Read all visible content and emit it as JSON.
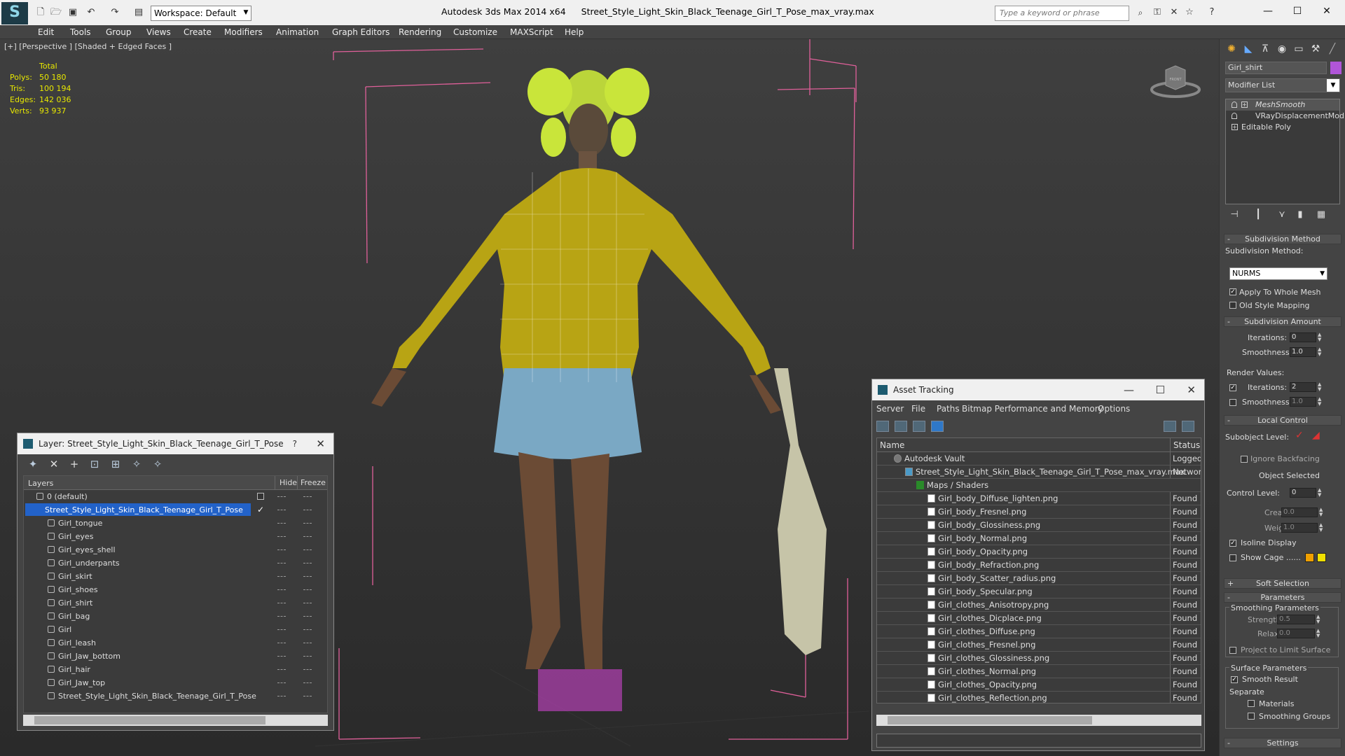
{
  "titlebar": {
    "workspace": "Workspace: Default",
    "app": "Autodesk 3ds Max  2014 x64",
    "file": "Street_Style_Light_Skin_Black_Teenage_Girl_T_Pose_max_vray.max",
    "search_placeholder": "Type a keyword or phrase",
    "controls": {
      "minimize": "—",
      "maximize": "☐",
      "close": "✕"
    }
  },
  "menu": [
    "Edit",
    "Tools",
    "Group",
    "Views",
    "Create",
    "Modifiers",
    "Animation",
    "Graph Editors",
    "Rendering",
    "Customize",
    "MAXScript",
    "Help"
  ],
  "viewport": {
    "label": "[+] [Perspective ] [Shaded + Edged Faces ]",
    "stats": {
      "header": "Total",
      "rows": [
        {
          "k": "Polys:",
          "v": "50 180"
        },
        {
          "k": "Tris:",
          "v": "100 194"
        },
        {
          "k": "Edges:",
          "v": "142 036"
        },
        {
          "k": "Verts:",
          "v": "93 937"
        }
      ]
    },
    "viewcube": "FRONT"
  },
  "layer_window": {
    "title": "Layer: Street_Style_Light_Skin_Black_Teenage_Girl_T_Pose",
    "help": "?",
    "close": "✕",
    "columns": {
      "layers": "Layers",
      "hide": "Hide",
      "freeze": "Freeze"
    },
    "rows": [
      {
        "name": "0 (default)",
        "indent": 1,
        "selected": false
      },
      {
        "name": "Street_Style_Light_Skin_Black_Teenage_Girl_T_Pose",
        "indent": 1,
        "selected": true
      },
      {
        "name": "Girl_tongue",
        "indent": 2
      },
      {
        "name": "Girl_eyes",
        "indent": 2
      },
      {
        "name": "Girl_eyes_shell",
        "indent": 2
      },
      {
        "name": "Girl_underpants",
        "indent": 2
      },
      {
        "name": "Girl_skirt",
        "indent": 2
      },
      {
        "name": "Girl_shoes",
        "indent": 2
      },
      {
        "name": "Girl_shirt",
        "indent": 2
      },
      {
        "name": "Girl_bag",
        "indent": 2
      },
      {
        "name": "Girl",
        "indent": 2
      },
      {
        "name": "Girl_leash",
        "indent": 2
      },
      {
        "name": "Girl_Jaw_bottom",
        "indent": 2
      },
      {
        "name": "Girl_hair",
        "indent": 2
      },
      {
        "name": "Girl_Jaw_top",
        "indent": 2
      },
      {
        "name": "Street_Style_Light_Skin_Black_Teenage_Girl_T_Pose",
        "indent": 2
      }
    ]
  },
  "asset_window": {
    "title": "Asset Tracking",
    "controls": {
      "minimize": "—",
      "maximize": "☐",
      "close": "✕"
    },
    "menu": [
      "Server",
      "File",
      "Paths",
      "Bitmap Performance and Memory",
      "Options"
    ],
    "columns": {
      "name": "Name",
      "status": "Status"
    },
    "rows": [
      {
        "name": "Autodesk Vault",
        "status": "Logged O",
        "indent": 1,
        "kind": "vault"
      },
      {
        "name": "Street_Style_Light_Skin_Black_Teenage_Girl_T_Pose_max_vray.max",
        "status": "Network",
        "indent": 2,
        "kind": "max"
      },
      {
        "name": "Maps / Shaders",
        "status": "",
        "indent": 3,
        "kind": "folder"
      },
      {
        "name": "Girl_body_Diffuse_lighten.png",
        "status": "Found",
        "indent": 4,
        "kind": "file"
      },
      {
        "name": "Girl_body_Fresnel.png",
        "status": "Found",
        "indent": 4,
        "kind": "file"
      },
      {
        "name": "Girl_body_Glossiness.png",
        "status": "Found",
        "indent": 4,
        "kind": "file"
      },
      {
        "name": "Girl_body_Normal.png",
        "status": "Found",
        "indent": 4,
        "kind": "file"
      },
      {
        "name": "Girl_body_Opacity.png",
        "status": "Found",
        "indent": 4,
        "kind": "file"
      },
      {
        "name": "Girl_body_Refraction.png",
        "status": "Found",
        "indent": 4,
        "kind": "file"
      },
      {
        "name": "Girl_body_Scatter_radius.png",
        "status": "Found",
        "indent": 4,
        "kind": "file"
      },
      {
        "name": "Girl_body_Specular.png",
        "status": "Found",
        "indent": 4,
        "kind": "file"
      },
      {
        "name": "Girl_clothes_Anisotropy.png",
        "status": "Found",
        "indent": 4,
        "kind": "file"
      },
      {
        "name": "Girl_clothes_Dicplace.png",
        "status": "Found",
        "indent": 4,
        "kind": "file"
      },
      {
        "name": "Girl_clothes_Diffuse.png",
        "status": "Found",
        "indent": 4,
        "kind": "file"
      },
      {
        "name": "Girl_clothes_Fresnel.png",
        "status": "Found",
        "indent": 4,
        "kind": "file"
      },
      {
        "name": "Girl_clothes_Glossiness.png",
        "status": "Found",
        "indent": 4,
        "kind": "file"
      },
      {
        "name": "Girl_clothes_Normal.png",
        "status": "Found",
        "indent": 4,
        "kind": "file"
      },
      {
        "name": "Girl_clothes_Opacity.png",
        "status": "Found",
        "indent": 4,
        "kind": "file"
      },
      {
        "name": "Girl_clothes_Reflection.png",
        "status": "Found",
        "indent": 4,
        "kind": "file"
      }
    ]
  },
  "command_panel": {
    "object_name": "Girl_shirt",
    "object_color": "#b055d8",
    "modifier_list": "Modifier List",
    "stack": [
      {
        "name": "MeshSmooth",
        "selected": true
      },
      {
        "name": "VRayDisplacementMod",
        "selected": false
      },
      {
        "name": "Editable Poly",
        "selected": false
      }
    ],
    "subdivision_method": {
      "header": "Subdivision Method",
      "label": "Subdivision Method:",
      "value": "NURMS",
      "apply_whole_mesh": "Apply To Whole Mesh",
      "old_style": "Old Style Mapping"
    },
    "subdivision_amount": {
      "header": "Subdivision Amount",
      "iterations_label": "Iterations:",
      "iterations": "0",
      "smoothness_label": "Smoothness:",
      "smoothness": "1.0",
      "render_values": "Render Values:",
      "r_iterations_label": "Iterations:",
      "r_iterations": "2",
      "r_smoothness_label": "Smoothness:",
      "r_smoothness": "1.0"
    },
    "local_control": {
      "header": "Local Control",
      "subobject": "Subobject Level:",
      "ignore_backfacing": "Ignore Backfacing",
      "object_selected": "Object Selected",
      "control_level_label": "Control Level:",
      "control_level": "0",
      "crease_label": "Crease:",
      "crease": "0.0",
      "weight_label": "Weight:",
      "weight": "1.0",
      "isoline": "Isoline Display",
      "show_cage": "Show Cage ......"
    },
    "soft_selection": "Soft Selection",
    "parameters": {
      "header": "Parameters",
      "smoothing": "Smoothing Parameters",
      "strength_label": "Strength:",
      "strength": "0.5",
      "relax_label": "Relax:",
      "relax": "0.0",
      "project": "Project to Limit Surface",
      "surface": "Surface Parameters",
      "smooth_result": "Smooth Result",
      "separate": "Separate",
      "materials": "Materials",
      "smoothing_groups": "Smoothing Groups"
    },
    "settings": "Settings",
    "cage_colors": [
      "#f0a000",
      "#f0e000"
    ]
  }
}
